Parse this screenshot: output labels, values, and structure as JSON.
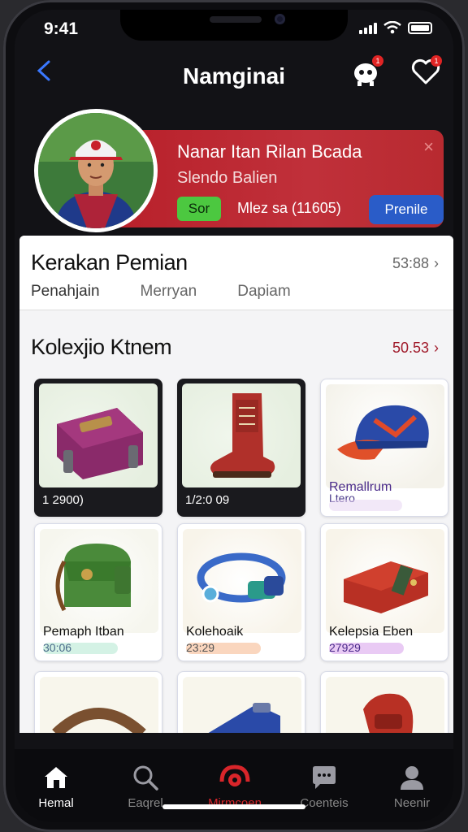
{
  "status_bar": {
    "time": "9:41"
  },
  "header": {
    "title": "Namginai",
    "notif_badge": "1",
    "fav_badge": "1"
  },
  "profile": {
    "name": "Nanar Itan Rilan Bcada",
    "subtitle": "Slendo Balien",
    "tag": "Sor",
    "meta": "Mlez sa (11605)",
    "profile_button": "Prenile",
    "close": "×"
  },
  "achievements": {
    "title": "Kerakan Pemian",
    "count": "53:88",
    "tabs": [
      "Penahjain",
      "Merryan",
      "Dapiam"
    ]
  },
  "collection": {
    "title": "Kolexjio Ktnem",
    "count": "50.53",
    "cards": [
      {
        "price": "1 2900)",
        "icon": "bag-icon"
      },
      {
        "price": "1/2:0 09",
        "icon": "boot-icon"
      },
      {
        "name": "Remallrum",
        "sub": "Ltero",
        "icon": "cap-icon"
      },
      {
        "name": "Pemaph Itban",
        "price": "30:06",
        "icon": "satchel-icon"
      },
      {
        "name": "Kolehoaik",
        "price": "23:29",
        "icon": "bracelet-icon"
      },
      {
        "name": "Kelepsia Eben",
        "price": "27929",
        "icon": "wallet-icon"
      }
    ]
  },
  "tabbar": {
    "items": [
      "Hemal",
      "Eaqrel",
      "Mirmcoen",
      "Coenteis",
      "Neenir"
    ]
  },
  "colors": {
    "accent": "#c0303a",
    "brand_blue": "#2a5cc8",
    "tag_green": "#4cc840"
  }
}
